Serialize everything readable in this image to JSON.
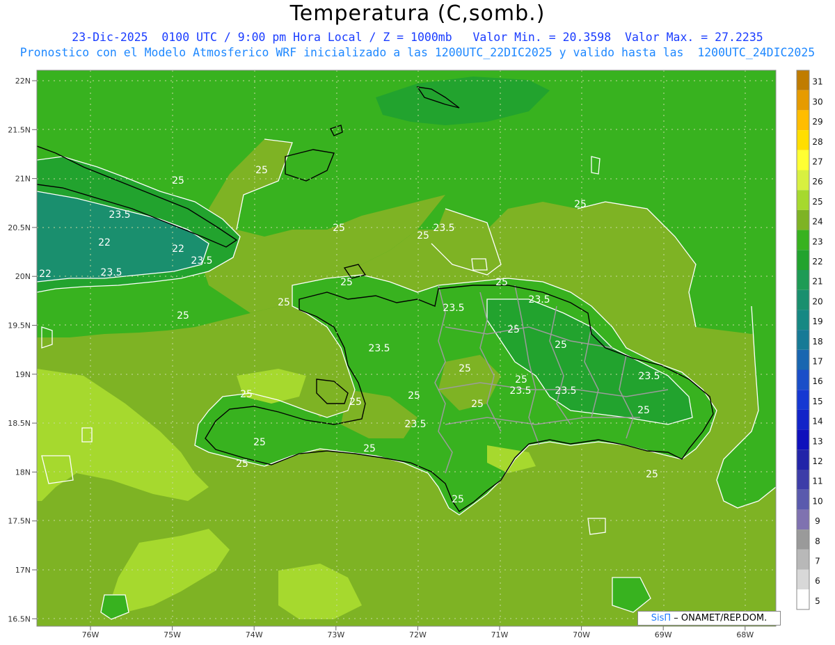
{
  "header": {
    "title": "Temperatura (C,somb.)",
    "line1": "23-Dic-2025  0100 UTC / 9:00 pm Hora Local / Z = 1000mb   Valor Min. = 20.3598  Valor Max. = 27.2235",
    "line2": "Pronostico con el Modelo Atmosferico WRF inicializado a las 1200UTC_22DIC2025 y valido hasta las  1200UTC_24DIC2025"
  },
  "axes": {
    "lat_labels": [
      "22N",
      "21.5N",
      "21N",
      "20.5N",
      "20N",
      "19.5N",
      "19N",
      "18.5N",
      "18N",
      "17.5N",
      "17N",
      "16.5N"
    ],
    "lon_labels": [
      "76W",
      "75W",
      "74W",
      "73W",
      "72W",
      "71W",
      "70W",
      "69W",
      "68W"
    ]
  },
  "colorbar": {
    "labels": [
      "31",
      "30",
      "29",
      "28",
      "27",
      "26",
      "25",
      "24",
      "23",
      "22",
      "21",
      "20",
      "19",
      "18",
      "17",
      "16",
      "15",
      "14",
      "13",
      "12",
      "11",
      "10",
      "9",
      "8",
      "7",
      "6",
      "5"
    ],
    "colors": [
      "#c07c00",
      "#e69b00",
      "#ffbd00",
      "#ffde00",
      "#ffff33",
      "#d8f040",
      "#a6d92e",
      "#7eb324",
      "#38b21f",
      "#22a32e",
      "#1e9b55",
      "#1a8f6e",
      "#168883",
      "#177a96",
      "#1966b0",
      "#1a4ec8",
      "#1638d2",
      "#1224c8",
      "#0f10bc",
      "#2224a8",
      "#3d3da8",
      "#5a5aad",
      "#7f72b0",
      "#9a9a9a",
      "#b8b8b8",
      "#d8d8d8",
      "#ffffff"
    ]
  },
  "contour_labels": [
    "25",
    "25",
    "23.5",
    "22",
    "22",
    "23.5",
    "22",
    "23.5",
    "25",
    "25",
    "25",
    "25",
    "23.5",
    "25",
    "25",
    "23.5",
    "23.5",
    "25",
    "25",
    "23.5",
    "25",
    "25",
    "23.5",
    "23.5",
    "25",
    "25",
    "25",
    "25",
    "25",
    "23.5",
    "23.5",
    "25",
    "25",
    "25",
    "25",
    "25",
    "25"
  ],
  "credit": {
    "brand": "SisΠ",
    "text": " – ONAMET/REP.DOM."
  },
  "colors": {
    "ocean": "#7eb324",
    "land": "#38b21f",
    "cool": "#22a32e",
    "coolest": "#1a8f6e",
    "warm": "#a6d92e"
  }
}
